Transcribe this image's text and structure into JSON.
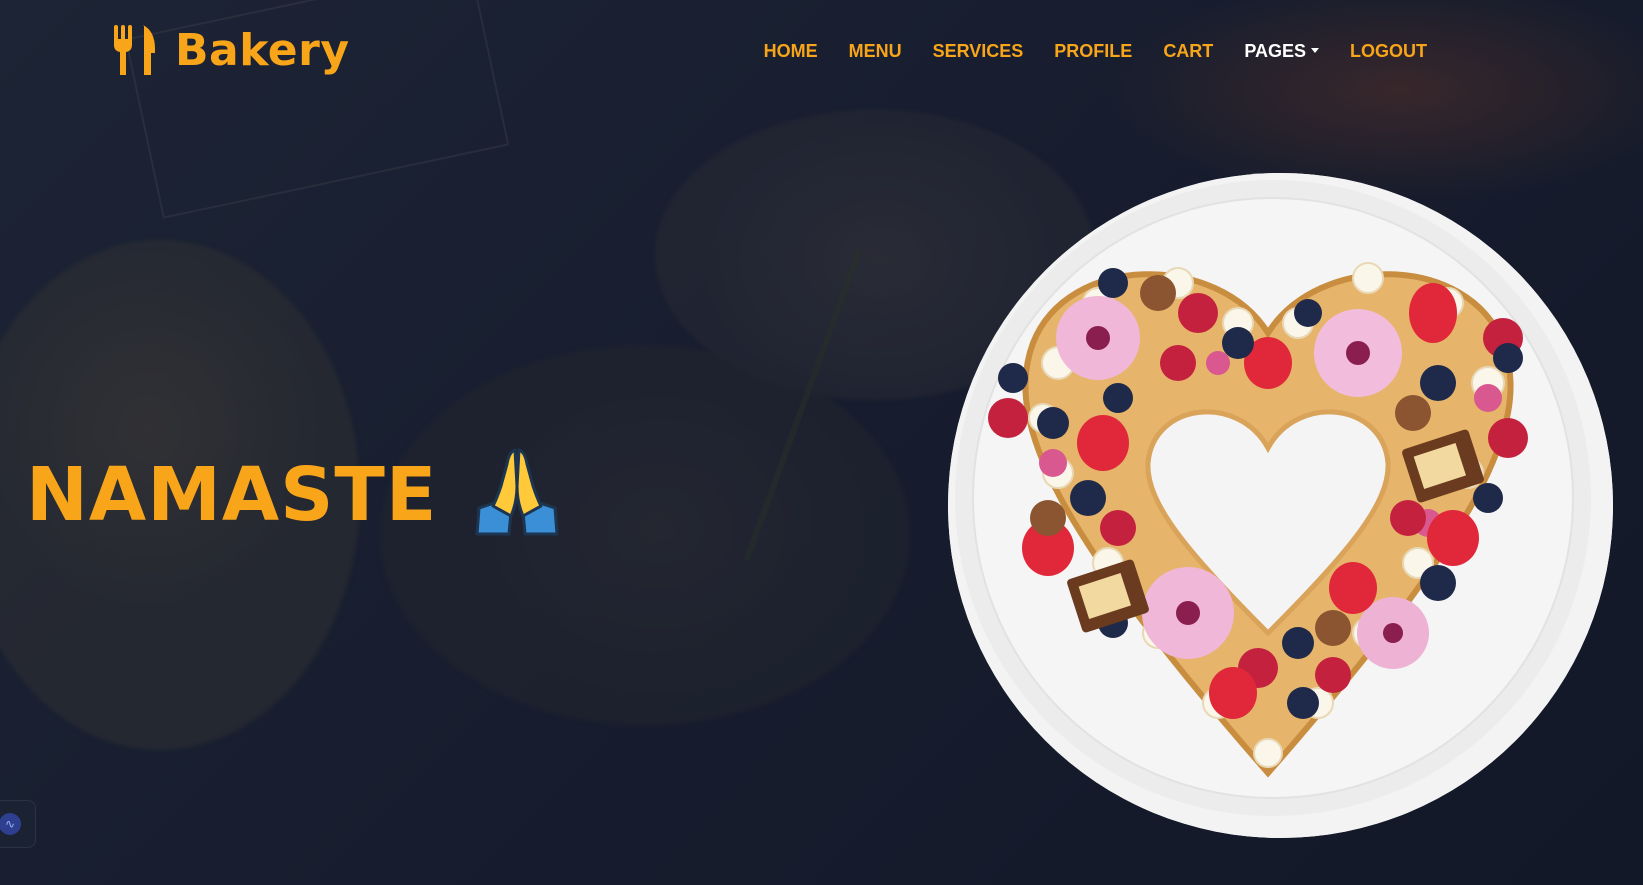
{
  "brand": {
    "name": "Bakery",
    "icon": "fork-knife-icon",
    "color": "#f9a51a"
  },
  "nav": {
    "items": [
      {
        "label": "HOME"
      },
      {
        "label": "MENU"
      },
      {
        "label": "SERVICES"
      },
      {
        "label": "PROFILE"
      },
      {
        "label": "CART"
      },
      {
        "label": "PAGES",
        "dropdown": true,
        "active": true
      },
      {
        "label": "LOGOUT"
      }
    ],
    "link_color": "#f9a51a",
    "active_color": "#ffffff"
  },
  "hero": {
    "heading": "NAMASTE",
    "emoji_icon": "folded-hands-icon",
    "image": "heart-shaped-cake-image"
  },
  "widget": {
    "icon": "audio-wave-icon"
  }
}
